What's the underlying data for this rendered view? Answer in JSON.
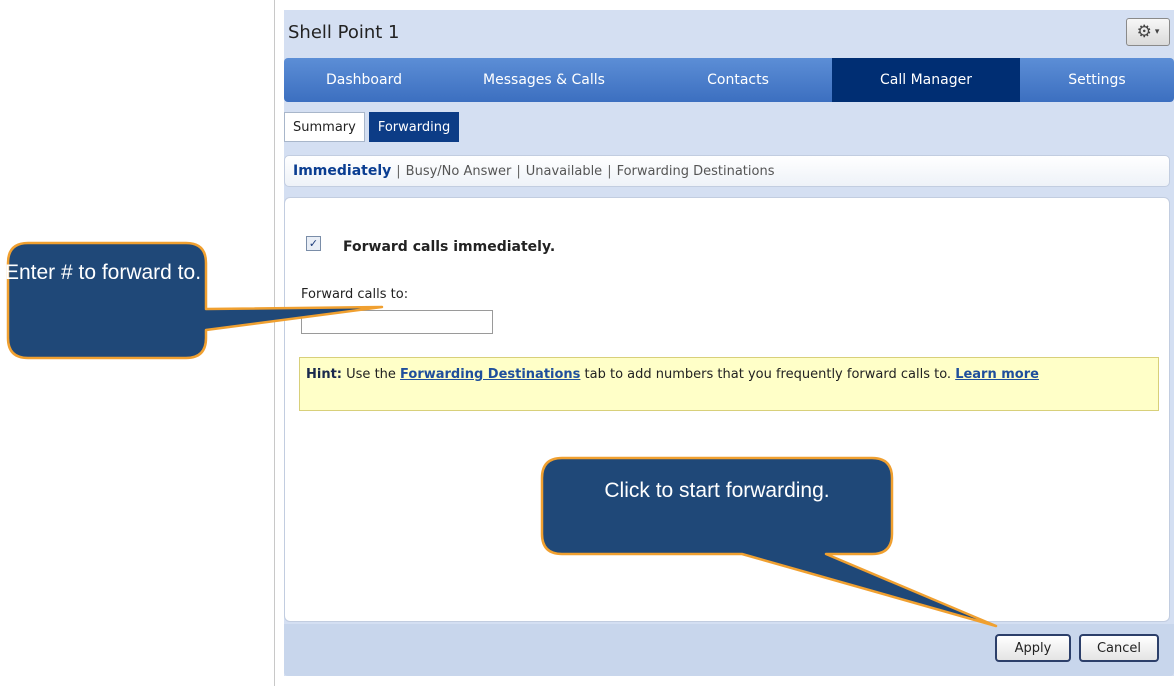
{
  "panel": {
    "title": "Shell Point 1",
    "gear_symbol": "⚙",
    "gear_caret": "▾"
  },
  "main_nav": [
    {
      "label": "Dashboard",
      "active": false
    },
    {
      "label": "Messages & Calls",
      "active": false
    },
    {
      "label": "Contacts",
      "active": false
    },
    {
      "label": "Call Manager",
      "active": true
    },
    {
      "label": "Settings",
      "active": false
    }
  ],
  "sub_tabs": [
    {
      "label": "Summary",
      "active": false
    },
    {
      "label": "Forwarding",
      "active": true
    }
  ],
  "forward_links": {
    "immediately": "Immediately",
    "busy": "Busy/No Answer",
    "unavailable": "Unavailable",
    "destinations": "Forwarding Destinations",
    "separator": "|"
  },
  "forward_form": {
    "checkbox_checked": true,
    "checkbox_mark": "✓",
    "checkbox_label": "Forward calls immediately.",
    "field_label": "Forward calls to:",
    "field_value": ""
  },
  "hint": {
    "label": "Hint:",
    "text_before": " Use the ",
    "link": "Forwarding Destinations",
    "text_after": " tab to add numbers that you frequently forward calls to. ",
    "learn_more": "Learn more"
  },
  "footer": {
    "apply_label": "Apply",
    "cancel_label": "Cancel"
  },
  "callouts": {
    "enter_number": "Enter # to forward to.",
    "start_forwarding": "Click to start forwarding."
  },
  "colors": {
    "nav_active": "#002e73",
    "callout_fill": "#1f4878",
    "callout_stroke": "#f0a030",
    "hint_bg": "#ffffc8"
  }
}
